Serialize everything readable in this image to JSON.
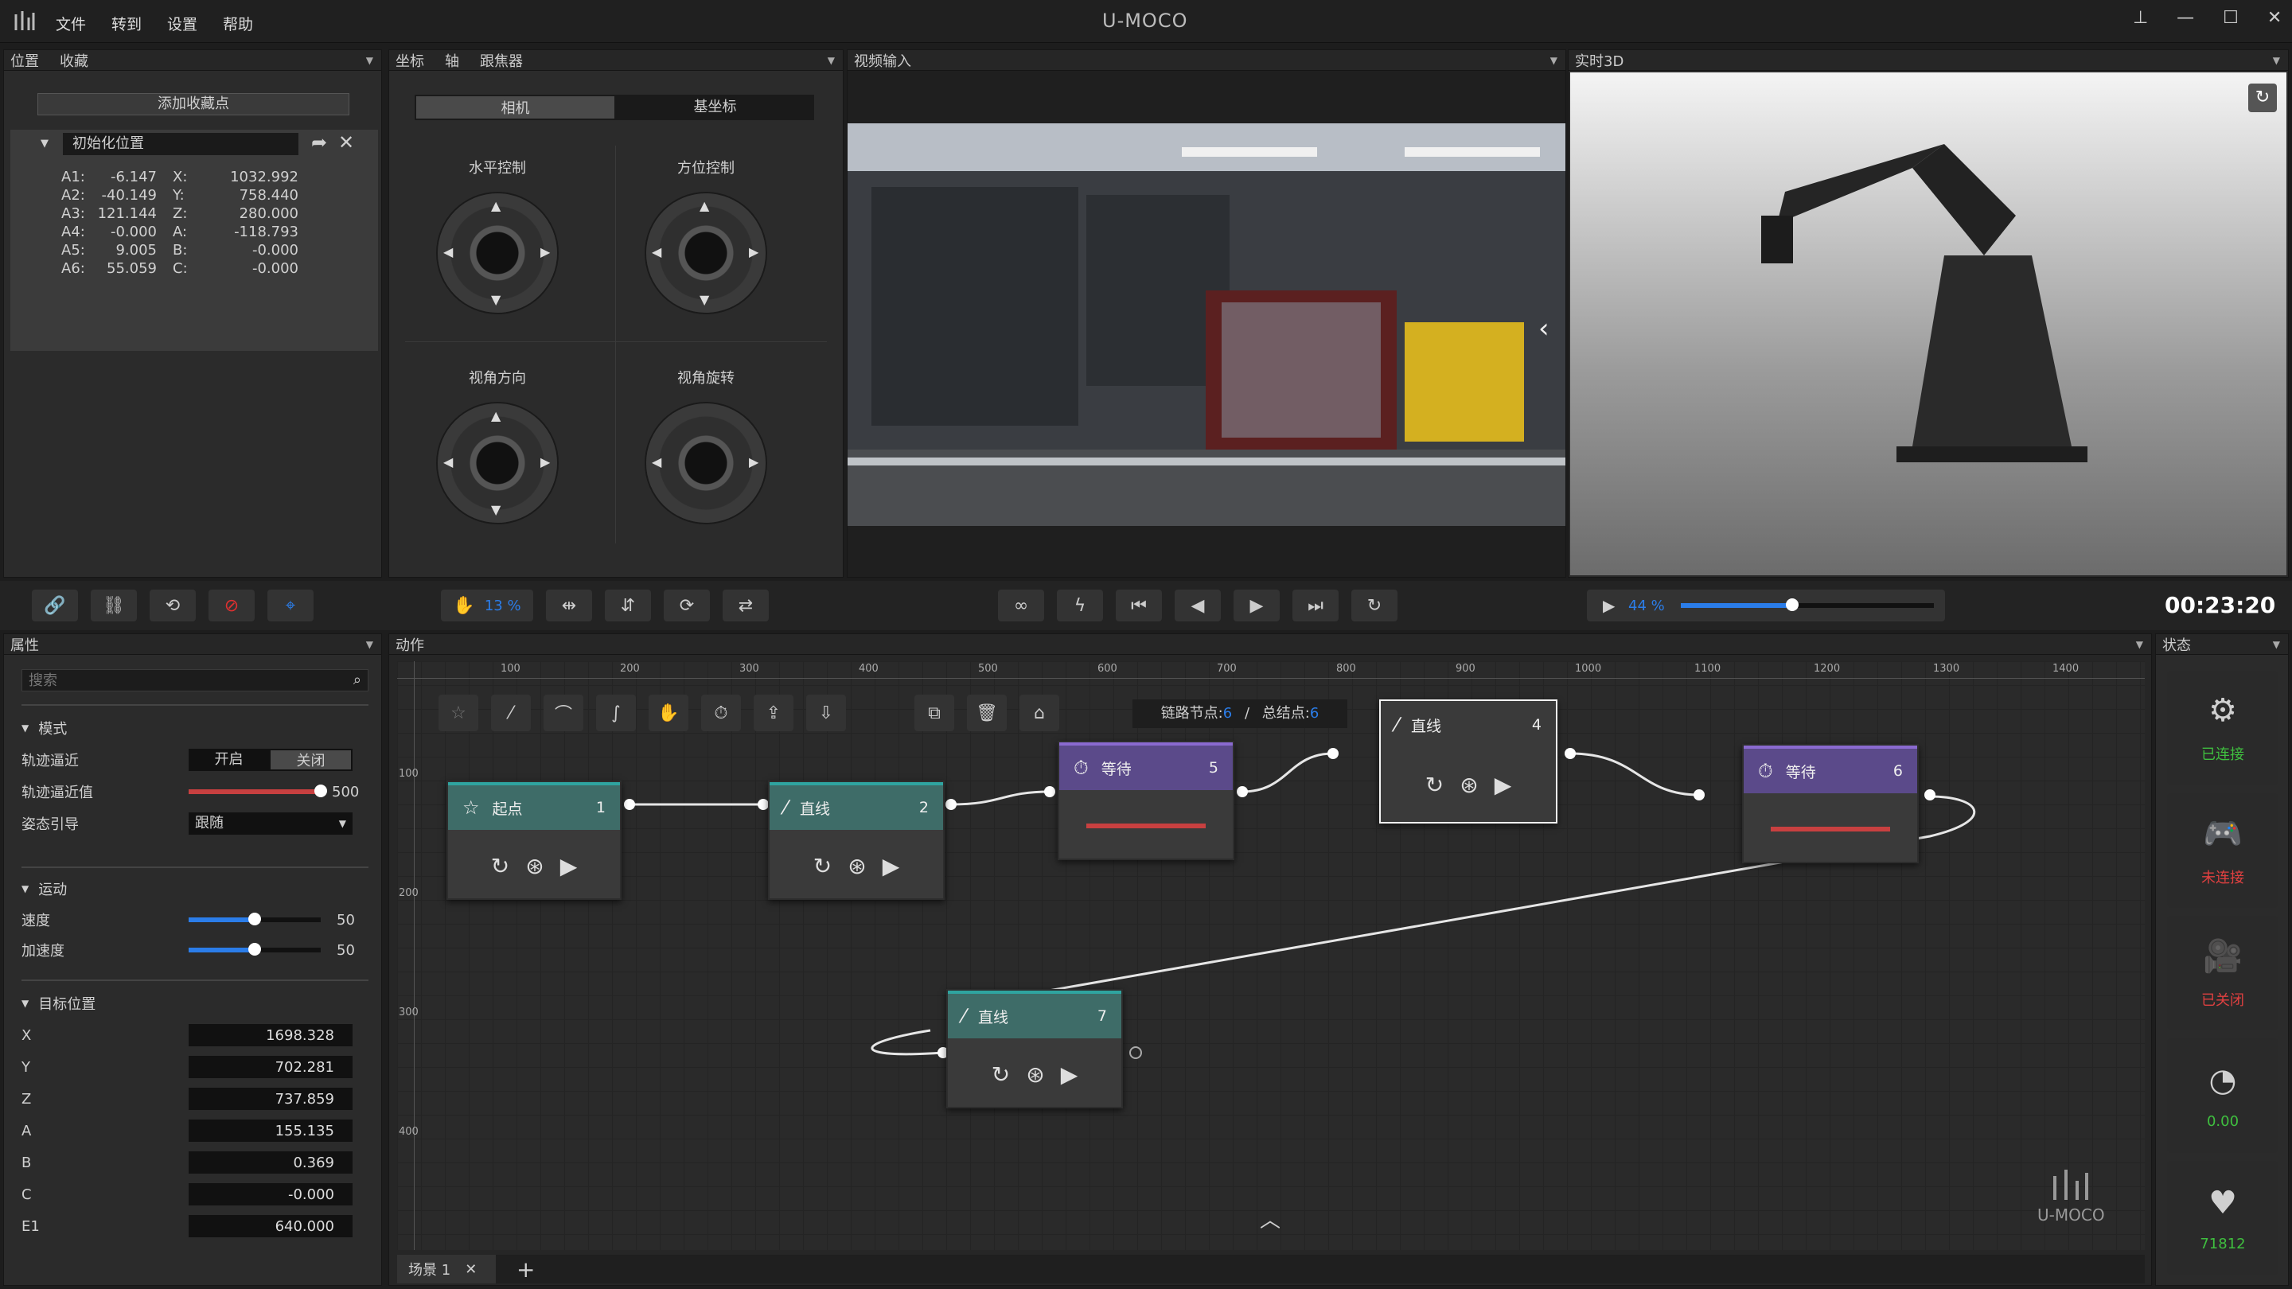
{
  "app": {
    "title": "U-MOCO",
    "menu": [
      "文件",
      "转到",
      "设置",
      "帮助"
    ]
  },
  "colors": {
    "accent": "#2b7de9",
    "purple": "#5b4a8a",
    "teal": "#3e6c68",
    "red": "#c84040",
    "connected": "#3fbf3f",
    "disconnected": "#e04040"
  },
  "favorites": {
    "tabs": [
      "位置",
      "收藏"
    ],
    "add_button": "添加收藏点",
    "item_name": "初始化位置",
    "rows": [
      [
        "A1:",
        "-6.147",
        "X:",
        "1032.992"
      ],
      [
        "A2:",
        "-40.149",
        "Y:",
        "758.440"
      ],
      [
        "A3:",
        "121.144",
        "Z:",
        "280.000"
      ],
      [
        "A4:",
        "-0.000",
        "A:",
        "-118.793"
      ],
      [
        "A5:",
        "9.005",
        "B:",
        "-0.000"
      ],
      [
        "A6:",
        "55.059",
        "C:",
        "-0.000"
      ]
    ]
  },
  "coord": {
    "tabs": [
      "坐标",
      "轴",
      "跟焦器"
    ],
    "toggle": [
      "相机",
      "基坐标"
    ],
    "joysticks": [
      "水平控制",
      "方位控制",
      "视角方向",
      "视角旋转"
    ]
  },
  "video": {
    "title": "视频输入"
  },
  "viewer3d": {
    "title": "实时3D"
  },
  "toolbar": {
    "speed": "13 %",
    "playback": "44 %",
    "playback_fraction": 0.44,
    "time": "00:23:20"
  },
  "props": {
    "title": "属性",
    "search_placeholder": "搜索",
    "mode": {
      "title": "模式",
      "approach_label": "轨迹逼近",
      "on": "开启",
      "off": "关闭",
      "approach_value_label": "轨迹逼近值",
      "approach_value": "500",
      "approach_fraction": 1.0,
      "guide_label": "姿态引导",
      "guide_value": "跟随"
    },
    "motion": {
      "title": "运动",
      "speed_label": "速度",
      "speed_value": "50",
      "speed_fraction": 0.5,
      "accel_label": "加速度",
      "accel_value": "50",
      "accel_fraction": 0.5
    },
    "target": {
      "title": "目标位置",
      "fields": [
        [
          "X",
          "1698.328"
        ],
        [
          "Y",
          "702.281"
        ],
        [
          "Z",
          "737.859"
        ],
        [
          "A",
          "155.135"
        ],
        [
          "B",
          "0.369"
        ],
        [
          "C",
          "-0.000"
        ],
        [
          "E1",
          "640.000"
        ]
      ]
    }
  },
  "actions": {
    "title": "动作",
    "ruler": [
      "100",
      "200",
      "300",
      "400",
      "500",
      "600",
      "700",
      "800",
      "900",
      "1000",
      "1100",
      "1200",
      "1300",
      "1400"
    ],
    "vruler": [
      "100",
      "200",
      "300",
      "400"
    ],
    "chain_label": "链路节点:",
    "chain_value": "6",
    "sep": "/",
    "total_label": "总结点:",
    "total_value": "6",
    "nodes": [
      {
        "name": "起点",
        "num": "1"
      },
      {
        "name": "直线",
        "num": "2"
      },
      {
        "name": "等待",
        "num": "5"
      },
      {
        "name": "直线",
        "num": "4"
      },
      {
        "name": "等待",
        "num": "6"
      },
      {
        "name": "直线",
        "num": "7"
      }
    ],
    "scene_tab": "场景 1",
    "add": "+"
  },
  "status": {
    "title": "状态",
    "items": [
      {
        "label": "已连接",
        "icon": "robot-arm-icon"
      },
      {
        "label": "未连接",
        "icon": "gamepad-icon"
      },
      {
        "label": "已关闭",
        "icon": "camera-icon"
      },
      {
        "label": "0.00",
        "icon": "gauge-icon"
      },
      {
        "label": "71812",
        "icon": "heartbeat-icon"
      }
    ],
    "logo": "U-MOCO"
  }
}
